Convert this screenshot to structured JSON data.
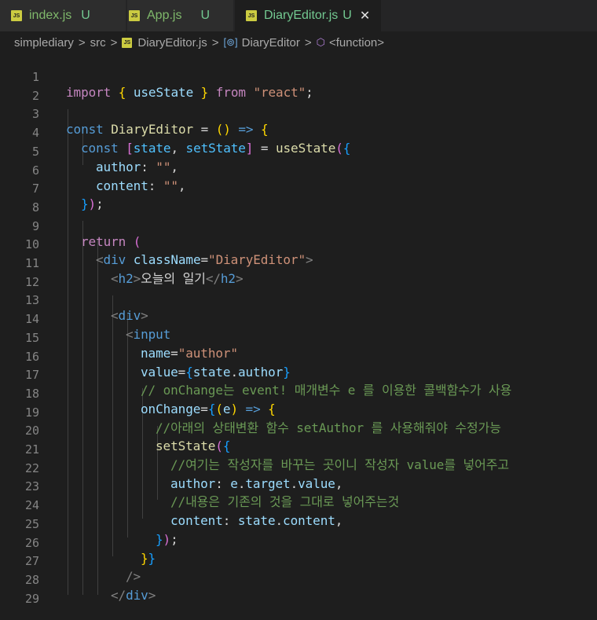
{
  "tabs": [
    {
      "file": "index.js",
      "status": "U",
      "active": false
    },
    {
      "file": "App.js",
      "status": "U",
      "active": false
    },
    {
      "file": "DiaryEditor.js",
      "status": "U",
      "active": true
    }
  ],
  "tab_close_glyph": "✕",
  "file_badge": "JS",
  "breadcrumbs": {
    "folder1": "simplediary",
    "folder2": "src",
    "file": "DiaryEditor.js",
    "symbol": "DiaryEditor",
    "function": "<function>",
    "separator": ">"
  },
  "line_numbers": [
    "1",
    "2",
    "3",
    "4",
    "5",
    "6",
    "7",
    "8",
    "9",
    "10",
    "11",
    "12",
    "13",
    "14",
    "15",
    "16",
    "17",
    "18",
    "19",
    "20",
    "21",
    "22",
    "23",
    "24",
    "25",
    "26",
    "27",
    "28",
    "29"
  ],
  "code": {
    "l1": {
      "import": "import",
      "b_open": "{",
      "useState": "useState",
      "b_close": "}",
      "from": "from",
      "module": "\"react\"",
      "semi": ";"
    },
    "l3": {
      "const": "const",
      "name": "DiaryEditor",
      "eq": "=",
      "paren": "()",
      "arrow": "=>",
      "brace": "{"
    },
    "l4": {
      "const": "const",
      "br_open": "[",
      "state": "state",
      "comma": ",",
      "setState": "setState",
      "br_close": "]",
      "eq": "=",
      "call": "useState",
      "p_open": "(",
      "c_open": "{"
    },
    "l5": {
      "key": "author",
      "colon": ":",
      "val": "\"\"",
      "comma": ","
    },
    "l6": {
      "key": "content",
      "colon": ":",
      "val": "\"\"",
      "comma": ","
    },
    "l7": {
      "c_close": "}",
      "p_close": ")",
      "semi": ";"
    },
    "l9": {
      "return": "return",
      "paren": "("
    },
    "l10": {
      "lt": "<",
      "tag": "div",
      "attr": "className",
      "eq": "=",
      "val": "\"DiaryEditor\"",
      "gt": ">"
    },
    "l11": {
      "open": "<",
      "tag": "h2",
      "gt": ">",
      "text": "오늘의 일기",
      "close_open": "</",
      "close_tag": "h2",
      "close_gt": ">"
    },
    "l13": {
      "lt": "<",
      "tag": "div",
      "gt": ">"
    },
    "l14": {
      "lt": "<",
      "tag": "input"
    },
    "l15": {
      "attr": "name",
      "eq": "=",
      "val": "\"author\""
    },
    "l16": {
      "attr": "value",
      "eq": "=",
      "b_open": "{",
      "obj": "state",
      "dot": ".",
      "prop": "author",
      "b_close": "}"
    },
    "l17": {
      "comment": "// onChange는 event! 매개변수 e 를 이용한 콜백함수가 사용"
    },
    "l18": {
      "attr": "onChange",
      "eq": "=",
      "b_open": "{",
      "p_open": "(",
      "param": "e",
      "p_close": ")",
      "arrow": "=>",
      "c_open": "{"
    },
    "l19": {
      "comment": "//아래의 상태변환 함수 setAuthor 를 사용해줘야 수정가능"
    },
    "l20": {
      "call": "setState",
      "p_open": "(",
      "c_open": "{"
    },
    "l21": {
      "comment": "//여기는 작성자를 바꾸는 곳이니 작성자 value를 넣어주고"
    },
    "l22": {
      "key": "author",
      "colon": ":",
      "obj": "e",
      "dot1": ".",
      "prop1": "target",
      "dot2": ".",
      "prop2": "value",
      "comma": ","
    },
    "l23": {
      "comment": "//내용은 기존의 것을 그대로 넣어주는것"
    },
    "l24": {
      "key": "content",
      "colon": ":",
      "obj": "state",
      "dot": ".",
      "prop": "content",
      "comma": ","
    },
    "l25": {
      "c_close": "}",
      "p_close": ")",
      "semi": ";"
    },
    "l26": {
      "c_close": "}",
      "b_close": "}"
    },
    "l27": {
      "self_close": "/>"
    },
    "l28": {
      "close_open": "</",
      "tag": "div",
      "gt": ">"
    }
  },
  "colors": {
    "background": "#1e1e1e",
    "tab_inactive": "#2d2d2d",
    "untracked_green": "#73c991",
    "js_badge": "#cbcb41",
    "keyword": "#569cd6",
    "control": "#c586c0",
    "variable": "#9cdcfe",
    "function": "#dcdcaa",
    "string": "#ce9178",
    "comment": "#6a9955"
  }
}
